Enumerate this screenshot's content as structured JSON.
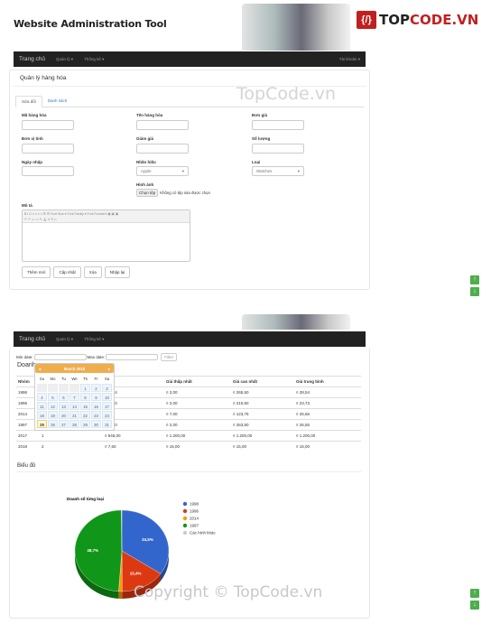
{
  "header": {
    "site_title": "Website Administration Tool",
    "logo_text_1": "TOP",
    "logo_text_2": "CODE.VN"
  },
  "nav": {
    "brand": "Trang chủ",
    "items": [
      "Quản lý ▾",
      "Thống kê ▾"
    ],
    "account": "Tài khoản ▾"
  },
  "watermarks": {
    "top": "TopCode.vn",
    "bottom": "Copyright © TopCode.vn"
  },
  "form_page": {
    "title": "Quản lý hàng hóa",
    "tabs": [
      "Sửa đổi",
      "Danh sách"
    ],
    "fields": {
      "ma_hang_hoa": "Mã hàng hóa",
      "ten_hang_hoa": "Tên hàng hóa",
      "don_gia": "Đơn giá",
      "don_vi_tinh": "Đơn vị tính",
      "giam_gia": "Giảm giá",
      "so_luong": "Số lượng",
      "ngay_nhap": "Ngày nhập",
      "nhan_hieu": "Nhãn hiệu",
      "loai": "Loại",
      "hinh_anh": "Hình ảnh",
      "mo_ta": "Mô tả"
    },
    "nhan_hieu_value": "Apple",
    "loai_value": "Watches",
    "file_button": "Chọn tệp",
    "file_status": "Không có tệp nào được chọn",
    "editor_toolbar": {
      "font_size": "Font Size",
      "font_family": "Font Family",
      "font_format": "Font Format"
    },
    "buttons": [
      "Thêm mới",
      "Cập nhật",
      "Xóa",
      "Nhập lại"
    ]
  },
  "report_page": {
    "min_date_label": "Min date:",
    "max_date_label": "Max date:",
    "filter_button": "Filter",
    "section_title": "Doanh",
    "calendar": {
      "month": "March 2018",
      "weekdays": [
        "Su",
        "Mo",
        "Tu",
        "We",
        "Th",
        "Fr",
        "Sa"
      ],
      "selected_day": "25"
    },
    "table": {
      "headers": [
        "Nhóm",
        "",
        "n số",
        "Giá thấp nhất",
        "Giá cao nhất",
        "Giá trung bình"
      ],
      "rows": [
        [
          "1998",
          "",
          "423,44",
          "¤ 2,00",
          "¤ 265,50",
          "¤ 28,54"
        ],
        [
          "1996",
          "",
          "210,30",
          "¤ 2,00",
          "¤ 210,60",
          "¤ 23,73"
        ],
        [
          "2014",
          "",
          "5,77",
          "¤ 7,00",
          "¤ 123,75",
          "¤ 25,66"
        ],
        [
          "1997",
          "",
          "056,10",
          "¤ 2,00",
          "¤ 263,50",
          "¤ 26,55"
        ],
        [
          "2017",
          "1",
          "¤ 546,00",
          "¤ 1.200,00",
          "¤ 1.200,00",
          "¤ 1.200,00"
        ],
        [
          "2018",
          "2",
          "¤ 7,60",
          "¤ 15,00",
          "¤ 15,00",
          "¤ 15,00"
        ]
      ]
    },
    "chart_section_title": "Biểu đồ"
  },
  "chart_data": {
    "type": "pie",
    "title": "Doanh số từng loại",
    "legend_position": "right",
    "categories": [
      "1998",
      "1996",
      "2014",
      "1997",
      "Các hình khác"
    ],
    "values": [
      34.5,
      15.4,
      1.2,
      48.7,
      0.2
    ],
    "labels": [
      "34,5%",
      "15,4%",
      "",
      "48,7%",
      ""
    ],
    "colors": [
      "#3366cc",
      "#dc3912",
      "#ff9900",
      "#109618",
      "#cccccc"
    ]
  }
}
